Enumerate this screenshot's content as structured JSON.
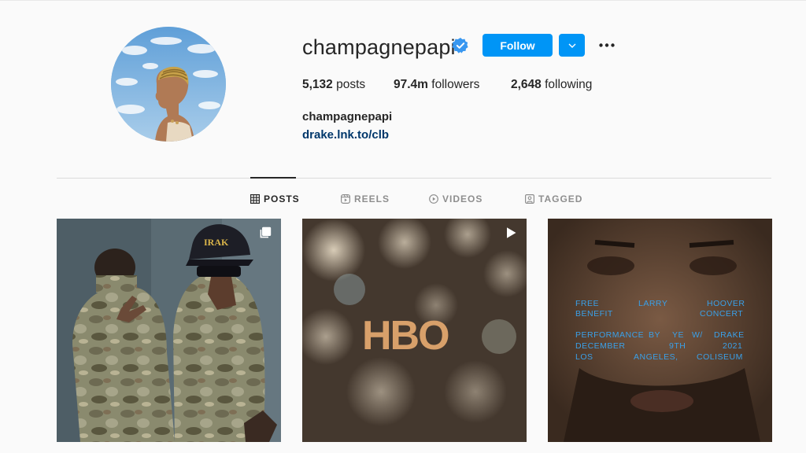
{
  "profile": {
    "username": "champagnepapi",
    "full_name": "champagnepapi",
    "link": "drake.lnk.to/clb",
    "follow_label": "Follow",
    "verified": true
  },
  "stats": [
    {
      "count": "5,132",
      "label": "posts"
    },
    {
      "count": "97.4m",
      "label": "followers"
    },
    {
      "count": "2,648",
      "label": "following"
    }
  ],
  "tabs": [
    {
      "label": "POSTS",
      "icon": "grid-icon",
      "active": true
    },
    {
      "label": "REELS",
      "icon": "reels-icon",
      "active": false
    },
    {
      "label": "VIDEOS",
      "icon": "video-icon",
      "active": false
    },
    {
      "label": "TAGGED",
      "icon": "tagged-icon",
      "active": false
    }
  ],
  "posts": [
    {
      "type": "carousel",
      "badge_icon": "carousel-icon",
      "cap_text": "IRAK"
    },
    {
      "type": "video",
      "badge_icon": "play-icon",
      "logo_text": "HBO"
    },
    {
      "type": "image",
      "poster_lines": [
        [
          "FREE",
          "LARRY",
          "HOOVER"
        ],
        [
          "BENEFIT",
          "CONCERT"
        ],
        [
          "PERFORMANCE",
          "BY",
          "YE",
          "W/",
          "DRAKE"
        ],
        [
          "DECEMBER",
          "9TH",
          "2021"
        ],
        [
          "LOS",
          "ANGELES,",
          "COLISEUM"
        ]
      ]
    }
  ],
  "colors": {
    "accent": "#0095f6",
    "link": "#00376b",
    "verified": "#3897f0",
    "poster_text": "#3aa0e8"
  }
}
